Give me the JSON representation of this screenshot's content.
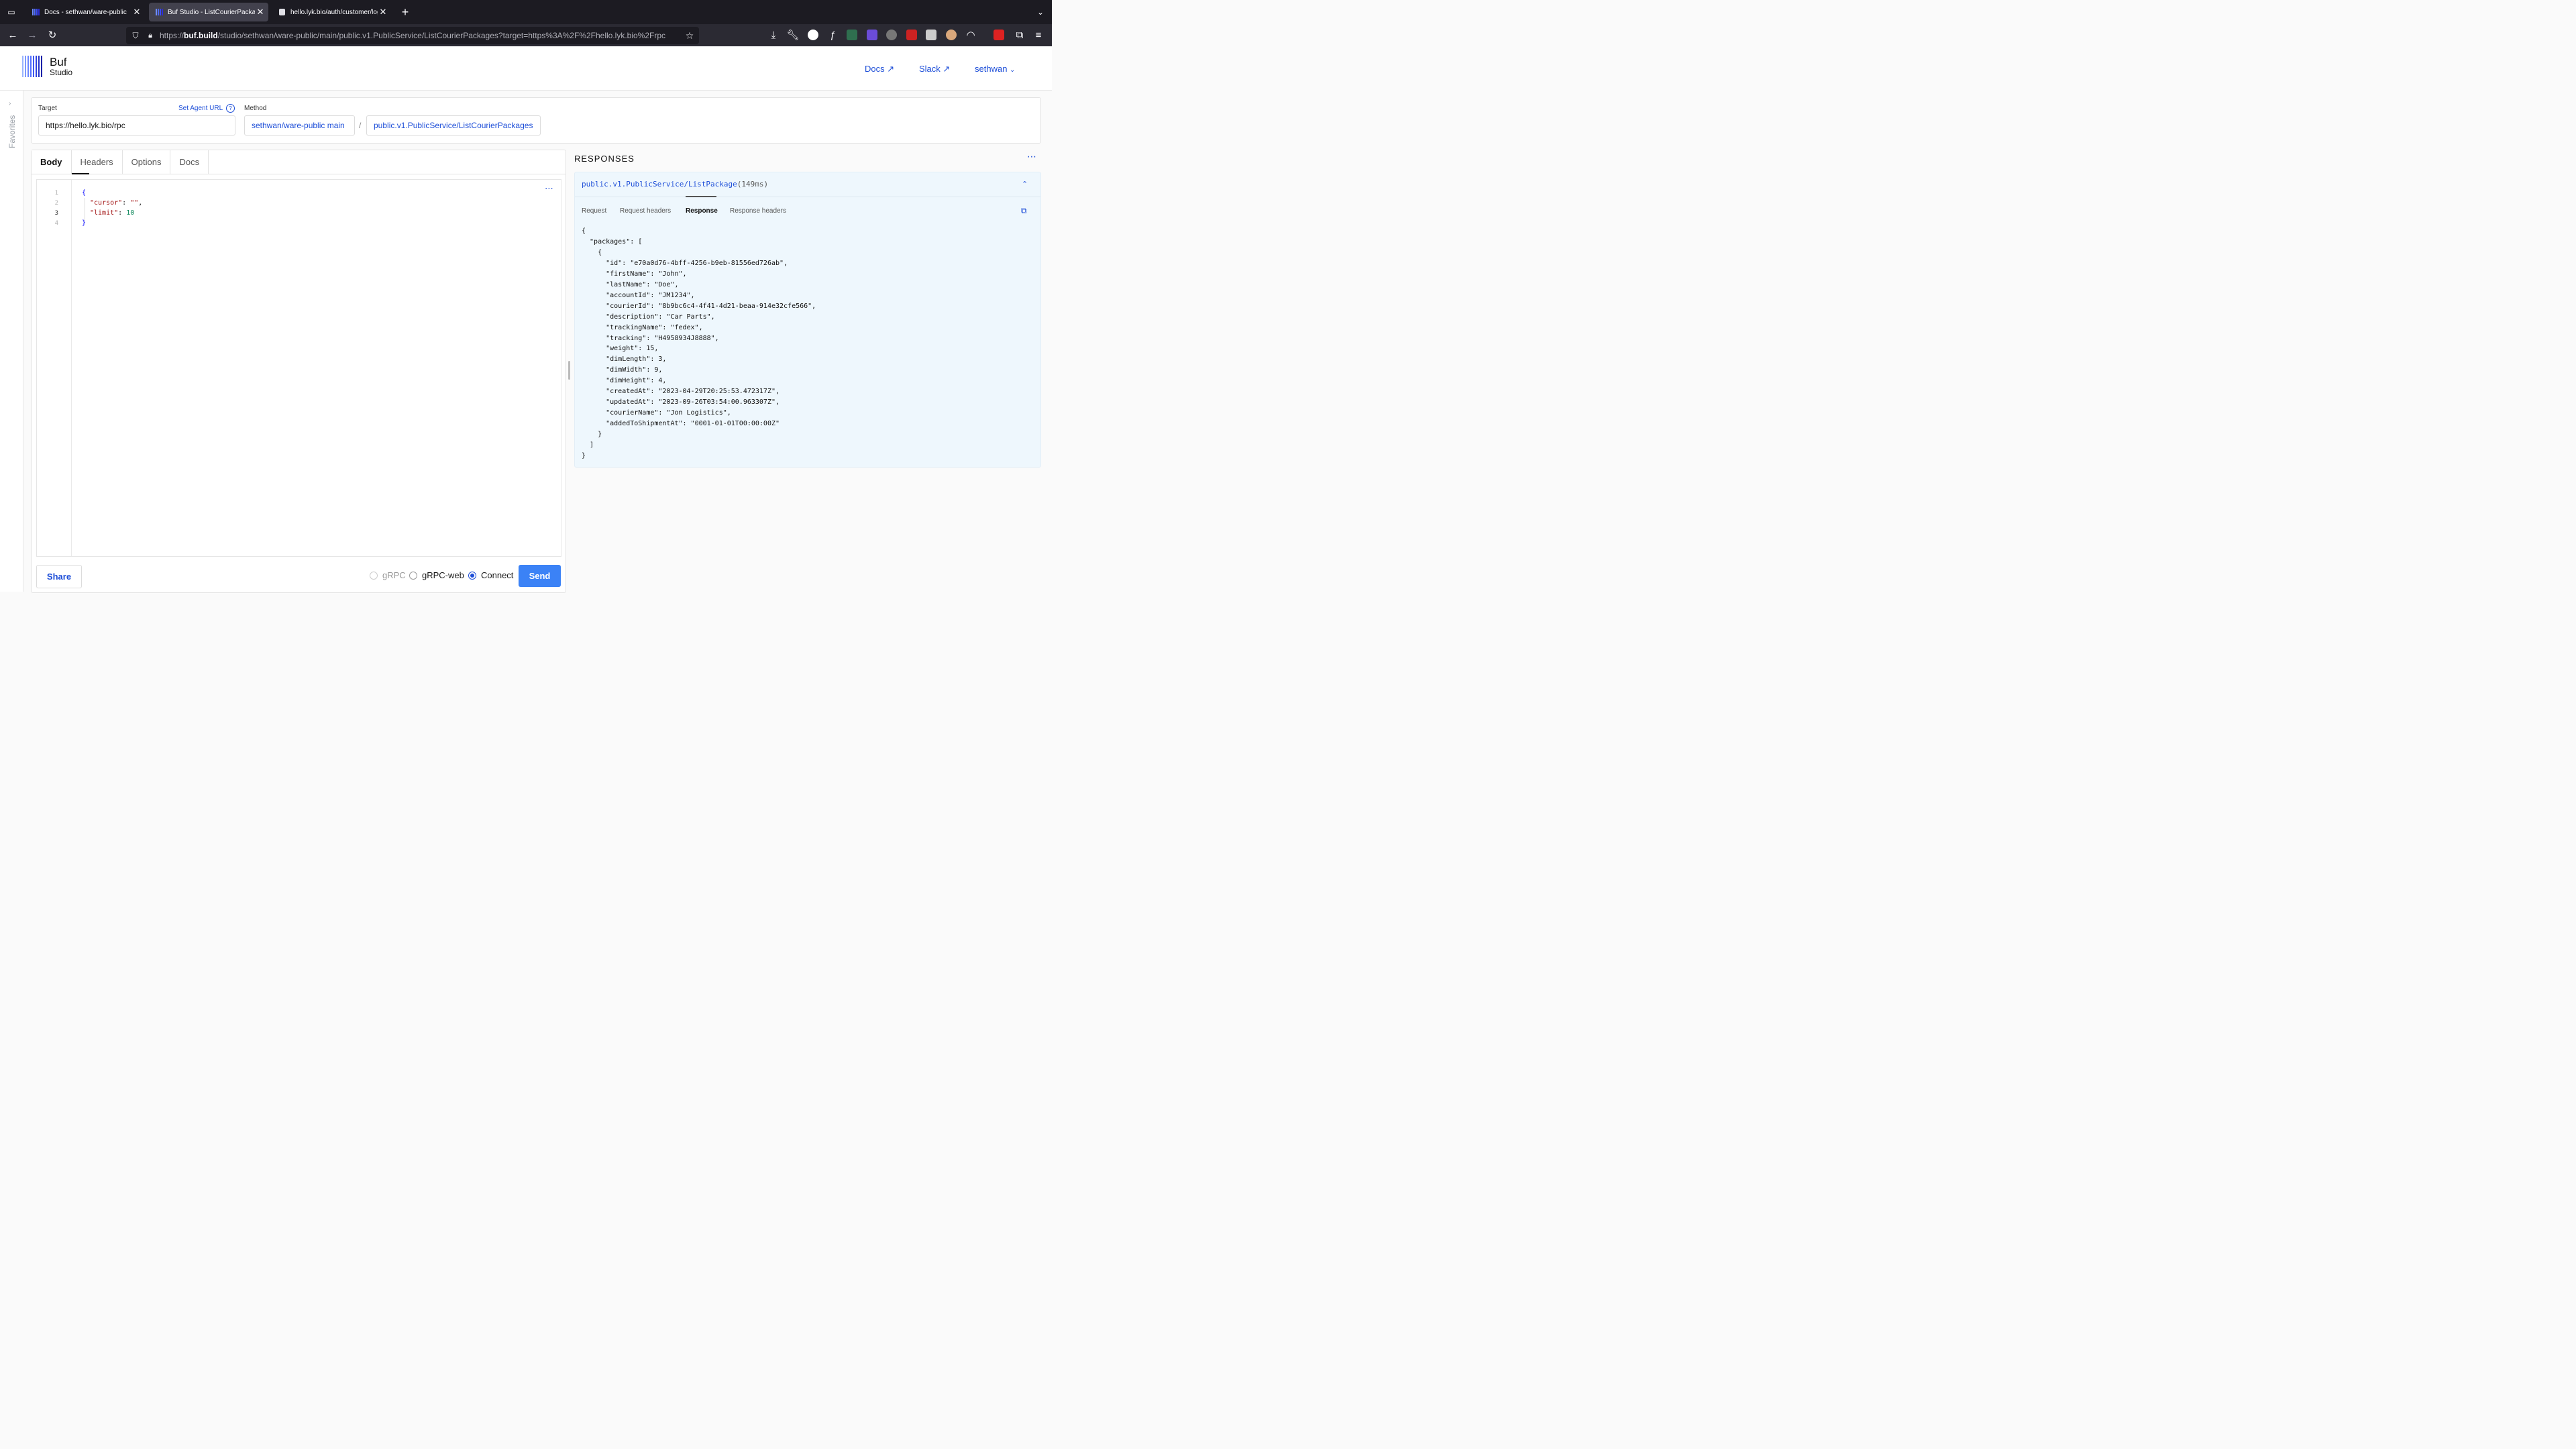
{
  "browser": {
    "tabs": [
      {
        "title": "Docs - sethwan/ware-public"
      },
      {
        "title": "Buf Studio - ListCourierPackages"
      },
      {
        "title": "hello.lyk.bio/auth/customer/login"
      }
    ],
    "url_prefix": "https://",
    "url_host": "buf.build",
    "url_path": "/studio/sethwan/ware-public/main/public.v1.PublicService/ListCourierPackages?target=https%3A%2F%2Fhello.lyk.bio%2Frpc"
  },
  "header": {
    "brand_title": "Buf",
    "brand_subtitle": "Studio",
    "docs": "Docs ↗",
    "slack": "Slack ↗",
    "user": "sethwan"
  },
  "sidebar": {
    "favorites": "Favorites"
  },
  "target": {
    "label": "Target",
    "agent_url": "Set Agent URL",
    "value": "https://hello.lyk.bio/rpc",
    "method_label": "Method",
    "module": "sethwan/ware-public main",
    "separator": "/",
    "method": "public.v1.PublicService/ListCourierPackages"
  },
  "editor": {
    "tabs": [
      "Body",
      "Headers",
      "Options",
      "Docs"
    ],
    "lines": [
      "1",
      "2",
      "3",
      "4"
    ],
    "code": {
      "open": "{",
      "cursor_key": "\"cursor\"",
      "cursor_val": "\"\"",
      "limit_key": "\"limit\"",
      "limit_val": "10",
      "close": "}"
    }
  },
  "footer": {
    "share": "Share",
    "protocols": [
      "gRPC",
      "gRPC-web",
      "Connect"
    ],
    "selected_protocol": "Connect",
    "send": "Send"
  },
  "responses": {
    "title": "RESPONSES",
    "method": "public.v1.PublicService/ListPackage",
    "timing": "(149ms)",
    "tabs": [
      "Request",
      "Request headers",
      "Response",
      "Response headers"
    ],
    "active_tab": "Response",
    "body": "{\n  \"packages\": [\n    {\n      \"id\": \"e70a0d76-4bff-4256-b9eb-81556ed726ab\",\n      \"firstName\": \"John\",\n      \"lastName\": \"Doe\",\n      \"accountId\": \"JM1234\",\n      \"courierId\": \"8b9bc6c4-4f41-4d21-beaa-914e32cfe566\",\n      \"description\": \"Car Parts\",\n      \"trackingName\": \"fedex\",\n      \"tracking\": \"H4958934J8888\",\n      \"weight\": 15,\n      \"dimLength\": 3,\n      \"dimWidth\": 9,\n      \"dimHeight\": 4,\n      \"createdAt\": \"2023-04-29T20:25:53.472317Z\",\n      \"updatedAt\": \"2023-09-26T03:54:00.963307Z\",\n      \"courierName\": \"Jon Logistics\",\n      \"addedToShipmentAt\": \"0001-01-01T00:00:00Z\"\n    }\n  ]\n}"
  },
  "colors": {
    "accent": "#1d4ed8",
    "send": "#3b82f6",
    "response_bg": "#eef7fd"
  }
}
